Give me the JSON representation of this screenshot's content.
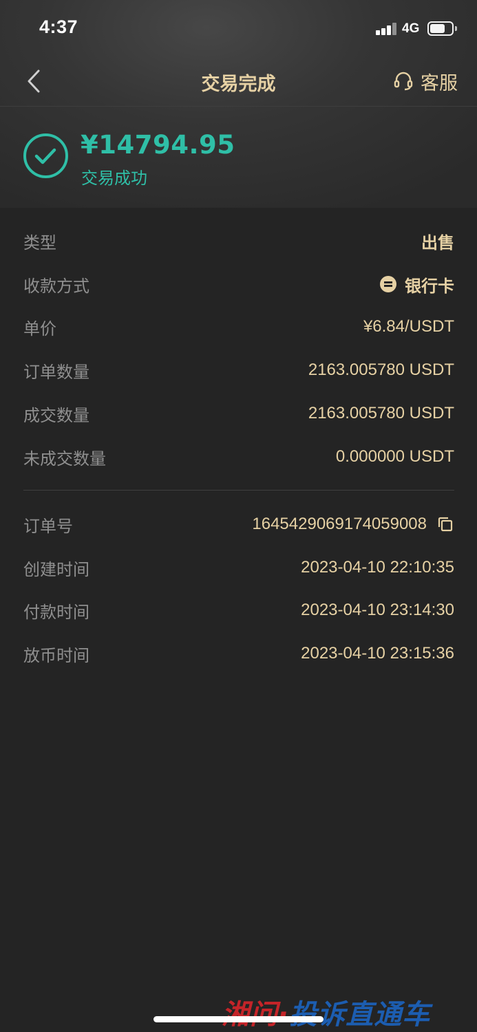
{
  "status_bar": {
    "time": "4:37",
    "network": "4G"
  },
  "nav": {
    "title": "交易完成",
    "service_label": "客服"
  },
  "summary": {
    "amount": "¥14794.95",
    "status": "交易成功"
  },
  "details": [
    {
      "label": "类型",
      "value": "出售"
    },
    {
      "label": "收款方式",
      "value": "银行卡"
    },
    {
      "label": "单价",
      "value": "¥6.84/USDT"
    },
    {
      "label": "订单数量",
      "value": "2163.005780 USDT"
    },
    {
      "label": "成交数量",
      "value": "2163.005780 USDT"
    },
    {
      "label": "未成交数量",
      "value": "0.000000 USDT"
    }
  ],
  "order_info": [
    {
      "label": "订单号",
      "value": "1645429069174059008"
    },
    {
      "label": "创建时间",
      "value": "2023-04-10 22:10:35"
    },
    {
      "label": "付款时间",
      "value": "2023-04-10 23:14:30"
    },
    {
      "label": "放币时间",
      "value": "2023-04-10 23:15:36"
    }
  ],
  "watermark": {
    "part1": "湘问·",
    "part2": "投诉直通车"
  },
  "colors": {
    "accent_gold": "#e6d1a4",
    "success_teal": "#2fbfa7",
    "label_gray": "#8f8f8f",
    "background": "#242424"
  },
  "icons": {
    "back": "chevron-left-icon",
    "service": "headset-icon",
    "success": "check-circle-icon",
    "bank": "bank-card-icon",
    "copy": "copy-icon"
  }
}
